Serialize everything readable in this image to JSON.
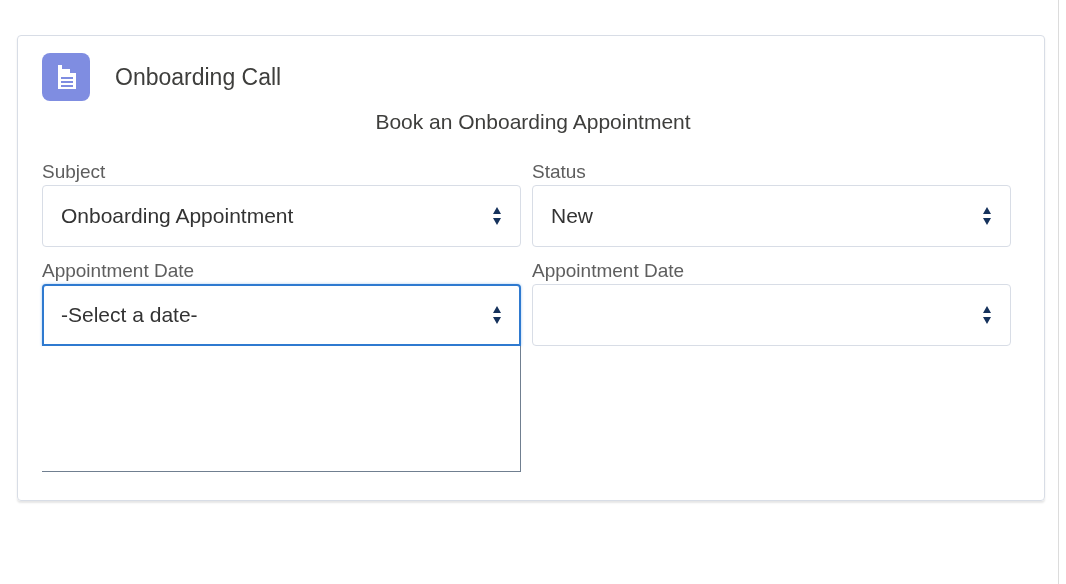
{
  "card": {
    "title": "Onboarding Call",
    "heading": "Book an Onboarding Appointment"
  },
  "fields": [
    {
      "label": "Subject",
      "value": "Onboarding Appointment",
      "focused": false,
      "expanded": false
    },
    {
      "label": "Status",
      "value": "New",
      "focused": false,
      "expanded": false
    },
    {
      "label": "Appointment Date",
      "value": "-Select a date-",
      "focused": true,
      "expanded": true
    },
    {
      "label": "Appointment Date",
      "focused": false,
      "expanded": false
    }
  ]
}
